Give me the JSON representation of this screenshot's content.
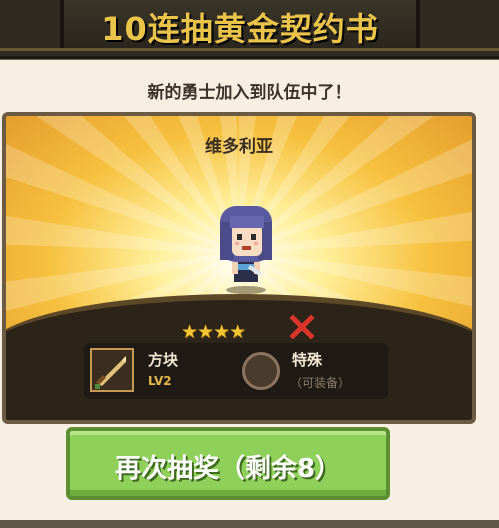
{
  "header": {
    "title": "10连抽黄金契约书"
  },
  "subtitle": "新的勇士加入到队伍中了！",
  "hero": {
    "name": "维多利亚",
    "stars": "★★★★",
    "star_count": 4
  },
  "slots": {
    "weapon": {
      "label": "方块",
      "level": "LV2"
    },
    "special": {
      "label": "特殊",
      "note": "（可装备）"
    }
  },
  "redraw_button": {
    "label": "再次抽奖（剩余8）"
  },
  "colors": {
    "title_gold": "#e9c34a",
    "button_green": "#8fd05a",
    "level_gold": "#e6b94a"
  }
}
